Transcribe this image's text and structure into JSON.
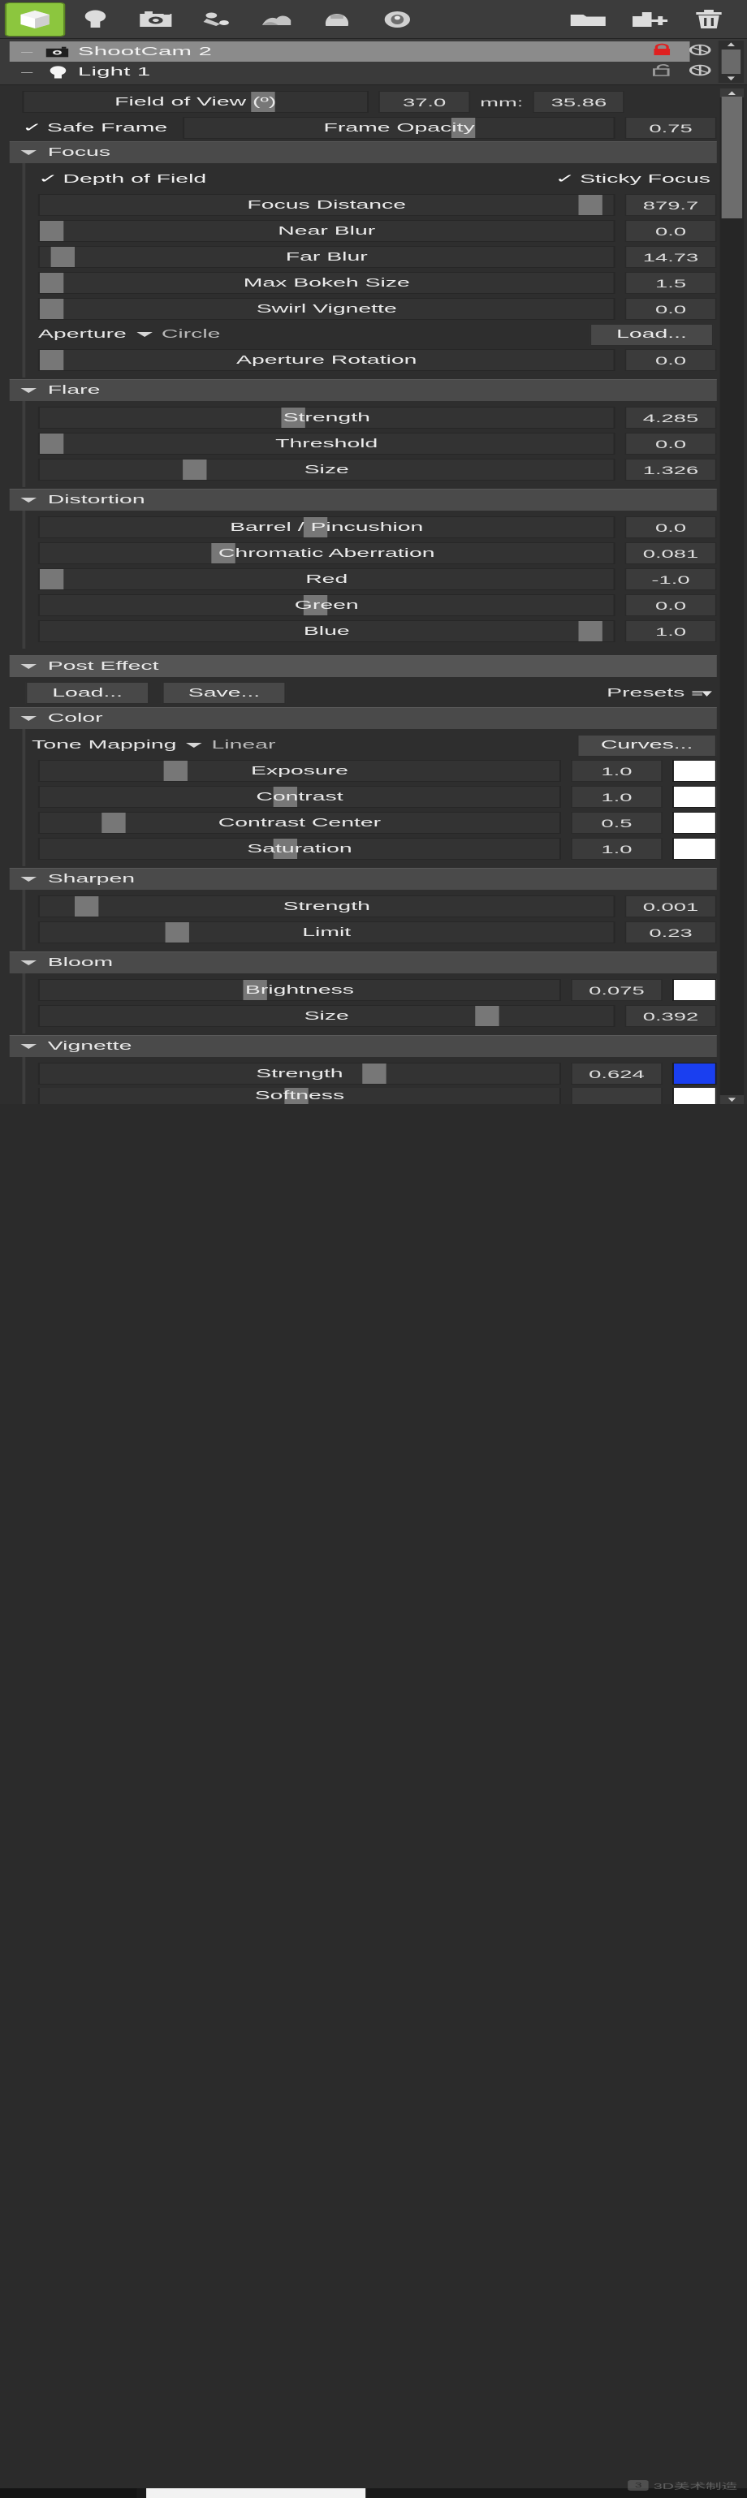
{
  "toolbar": {
    "items": [
      {
        "name": "model-icon",
        "label": "Model",
        "active": true
      },
      {
        "name": "light-icon",
        "label": "Light",
        "active": false
      },
      {
        "name": "camera-icon",
        "label": "Camera",
        "active": false
      },
      {
        "name": "animation-icon",
        "label": "Animation",
        "active": false
      },
      {
        "name": "environment-icon",
        "label": "Environment",
        "active": false
      },
      {
        "name": "backplate-icon",
        "label": "Backplate",
        "active": false
      },
      {
        "name": "material-icon",
        "label": "Material",
        "active": false
      },
      {
        "name": "folder-icon",
        "label": "Folder",
        "active": false
      },
      {
        "name": "add-folder-icon",
        "label": "Add Folder",
        "active": false
      },
      {
        "name": "delete-icon",
        "label": "Delete",
        "active": false
      }
    ]
  },
  "tree": {
    "rows": [
      {
        "label": "ShootCam 2",
        "icon": "camera-icon",
        "selected": true,
        "locked": true,
        "visibility": "visible"
      },
      {
        "label": "Light 1",
        "icon": "light-bulb-icon",
        "selected": false,
        "locked": false,
        "visibility": "visible"
      }
    ]
  },
  "camera": {
    "fov": {
      "label": "Field of View (º)",
      "value": "37.0",
      "handle_pct": 66
    },
    "mm": {
      "label": "mm:",
      "value": "35.86"
    },
    "safe_frame": {
      "label": "Safe Frame",
      "checked": true
    },
    "frame_opacity": {
      "label": "Frame Opacity",
      "value": "0.75",
      "handle_pct": 62
    }
  },
  "focus": {
    "title": "Focus",
    "depth_of_field": {
      "label": "Depth of Field",
      "checked": true
    },
    "sticky_focus": {
      "label": "Sticky Focus",
      "checked": true
    },
    "sliders": [
      {
        "label": "Focus Distance",
        "value": "879.7",
        "handle_pct": 94
      },
      {
        "label": "Near Blur",
        "value": "0.0",
        "handle_pct": 0
      },
      {
        "label": "Far Blur",
        "value": "14.73",
        "handle_pct": 2
      },
      {
        "label": "Max Bokeh Size",
        "value": "1.5",
        "handle_pct": 0
      },
      {
        "label": "Swirl Vignette",
        "value": "0.0",
        "handle_pct": 0
      }
    ],
    "aperture": {
      "label": "Aperture",
      "value": "Circle",
      "load_label": "Load..."
    },
    "aperture_rotation": {
      "label": "Aperture Rotation",
      "value": "0.0",
      "handle_pct": 0
    }
  },
  "flare": {
    "title": "Flare",
    "sliders": [
      {
        "label": "Strength",
        "value": "4.285",
        "handle_pct": 42
      },
      {
        "label": "Threshold",
        "value": "0.0",
        "handle_pct": 0
      },
      {
        "label": "Size",
        "value": "1.326",
        "handle_pct": 25
      }
    ]
  },
  "distortion": {
    "title": "Distortion",
    "sliders": [
      {
        "label": "Barrel / Pincushion",
        "value": "0.0",
        "handle_pct": 46
      },
      {
        "label": "Chromatic Aberration",
        "value": "0.081",
        "handle_pct": 30
      },
      {
        "label": "Red",
        "value": "-1.0",
        "handle_pct": 0
      },
      {
        "label": "Green",
        "value": "0.0",
        "handle_pct": 46
      },
      {
        "label": "Blue",
        "value": "1.0",
        "handle_pct": 94
      }
    ]
  },
  "post_effect": {
    "title": "Post Effect",
    "load_label": "Load...",
    "save_label": "Save...",
    "presets_label": "Presets"
  },
  "color": {
    "title": "Color",
    "tone_mapping": {
      "label": "Tone Mapping",
      "value": "Linear"
    },
    "curves_label": "Curves...",
    "sliders": [
      {
        "label": "Exposure",
        "value": "1.0",
        "handle_pct": 24,
        "swatch": "#ffffff"
      },
      {
        "label": "Contrast",
        "value": "1.0",
        "handle_pct": 45,
        "swatch": "#ffffff"
      },
      {
        "label": "Contrast Center",
        "value": "0.5",
        "handle_pct": 12,
        "swatch": "#ffffff"
      },
      {
        "label": "Saturation",
        "value": "1.0",
        "handle_pct": 45,
        "swatch": "#ffffff"
      }
    ]
  },
  "sharpen": {
    "title": "Sharpen",
    "sliders": [
      {
        "label": "Strength",
        "value": "0.001",
        "handle_pct": 6
      },
      {
        "label": "Limit",
        "value": "0.23",
        "handle_pct": 22
      }
    ]
  },
  "bloom": {
    "title": "Bloom",
    "sliders": [
      {
        "label": "Brightness",
        "value": "0.075",
        "handle_pct": 39,
        "swatch": "#ffffff"
      },
      {
        "label": "Size",
        "value": "0.392",
        "handle_pct": 76
      }
    ]
  },
  "vignette": {
    "title": "Vignette",
    "sliders": [
      {
        "label": "Strength",
        "value": "0.624",
        "handle_pct": 62,
        "swatch": "#1a3ff0"
      },
      {
        "label": "Softness",
        "value": "",
        "handle_pct": 47
      }
    ]
  },
  "watermark": {
    "text": "3D美术制造"
  }
}
